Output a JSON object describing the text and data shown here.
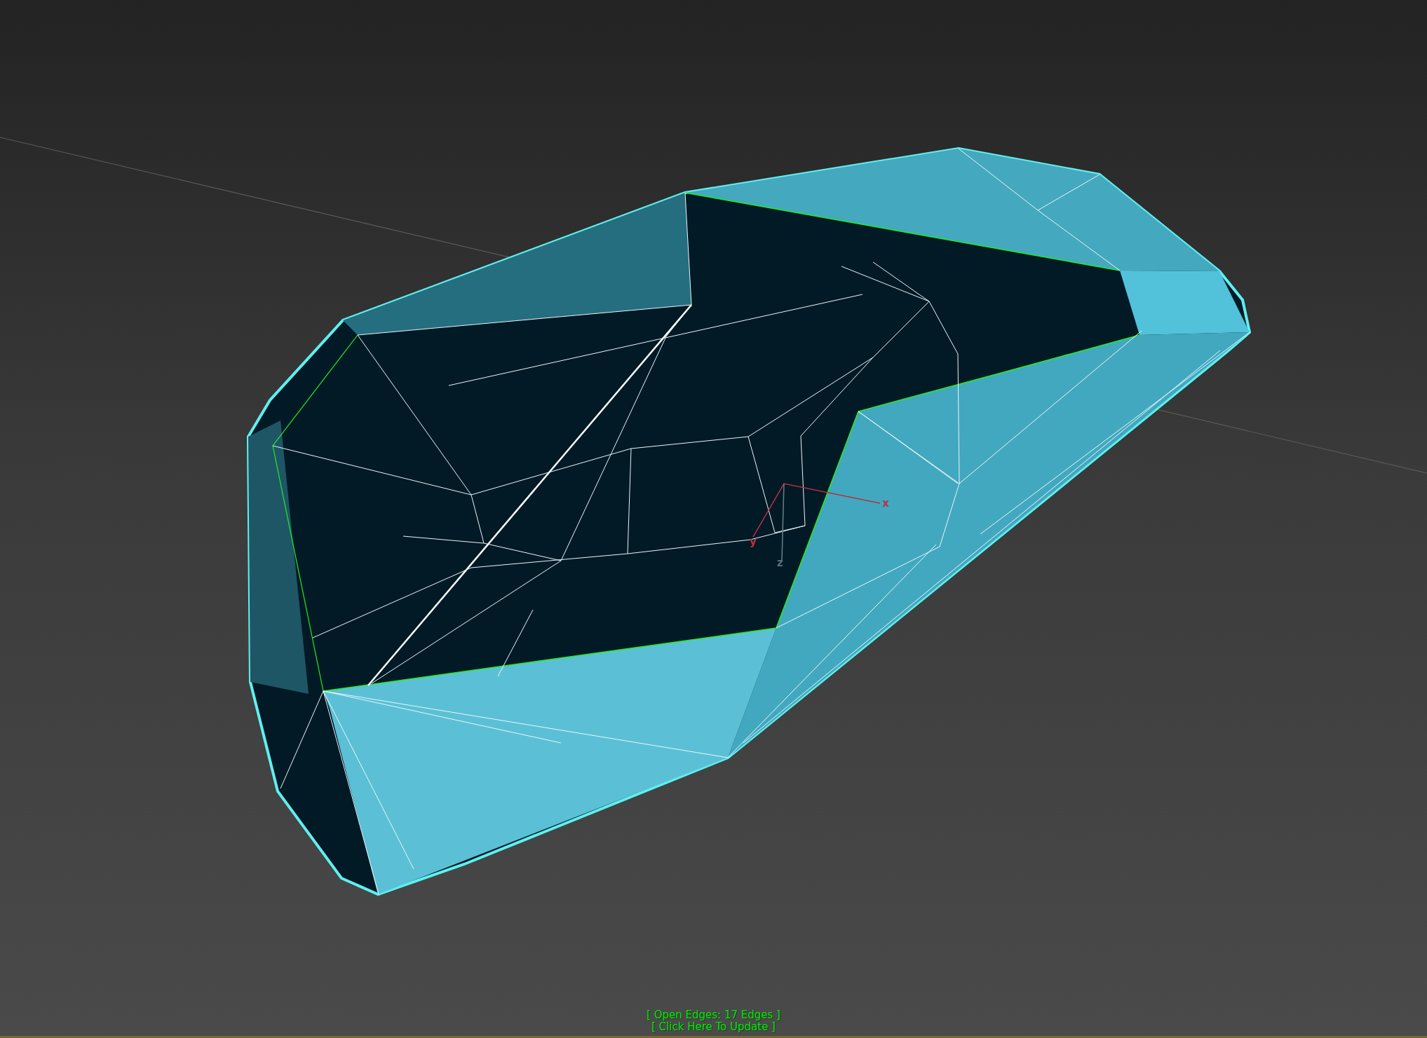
{
  "viewport": {
    "gizmo_labels": [
      "x",
      "y",
      "z"
    ],
    "status_lines": [
      "[ Open Edges: 17 Edges ]",
      "[ Click Here To Update ]"
    ]
  }
}
